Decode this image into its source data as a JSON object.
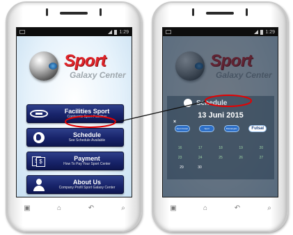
{
  "app": {
    "logo_title": "Sport",
    "logo_subtitle": "Galaxy Center",
    "status_time": "1:29"
  },
  "menu": {
    "items": [
      {
        "title": "Facilities Sport",
        "desc": "Contaents Sport Facilities",
        "icon": "stadium-icon"
      },
      {
        "title": "Schedule",
        "desc": "See Schedule Available",
        "icon": "globe-icon"
      },
      {
        "title": "Payment",
        "desc": "How To Pay Your Sport Center",
        "icon": "money-icon"
      },
      {
        "title": "About Us",
        "desc": "Company Profil Sport Galaxy Center",
        "icon": "user-icon"
      }
    ]
  },
  "schedule_popup": {
    "title": "Schedule",
    "date": "13 Juni 2015",
    "sports": [
      "Sport Futsal",
      "Sport Badminton",
      "Bulutangkis",
      "Futsal"
    ],
    "highlight_sport": "Futsal",
    "dates_row1": [
      "16",
      "17",
      "18",
      "19",
      "20"
    ],
    "dates_row2": [
      "23",
      "24",
      "25",
      "26",
      "27"
    ],
    "dates_row3": [
      "29",
      "30"
    ]
  },
  "navbar": {
    "buttons": [
      "▣",
      "⌂",
      "↶",
      "⌕"
    ]
  },
  "colors": {
    "accent": "#e0242a",
    "menu_bg": "#18246a",
    "annotation": "#e60000"
  }
}
